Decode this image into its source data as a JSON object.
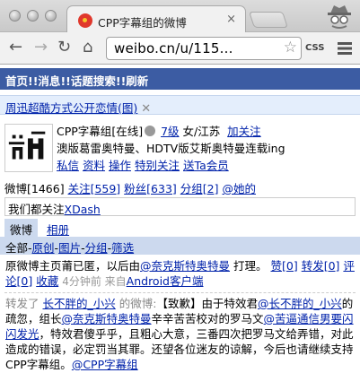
{
  "browser": {
    "tab_title": "CPP字幕组的微博",
    "tab_close": "×",
    "url": "weibo.cn/u/115...",
    "css_label": "CSS"
  },
  "nav": {
    "items": [
      "首页",
      "消息",
      "话题",
      "搜索",
      "刷新"
    ],
    "separator": "!!"
  },
  "notice": {
    "text": "周迅超酷方式公开恋情(图)",
    "close": "✕"
  },
  "profile": {
    "name": "CPP字幕组",
    "status": "[在线]",
    "level": "7级",
    "gender_location": "女/江苏",
    "follow": "加关注",
    "bio": "澳版葛雷奥特曼、HDTV版艾斯奥特曼连载ing",
    "links": [
      "私信",
      "资料",
      "操作",
      "特别关注",
      "送Ta会员"
    ]
  },
  "stats": {
    "weibo": "微博[1466]",
    "following": "关注[559]",
    "fans": "粉丝[633]",
    "groups": "分组[2]",
    "at_her": "@她的"
  },
  "common": {
    "prefix": "我们都关注",
    "user": "XDash"
  },
  "tabs": {
    "weibo": "微博",
    "album": "相册"
  },
  "filter": {
    "all": "全部",
    "original": "原创",
    "pics": "图片",
    "groups": "分组",
    "select": "筛选"
  },
  "post1": {
    "text_a": "原微博主页莆已匿，以后由",
    "mention": "@奈克斯特奥特曼",
    "text_b": " 打理。",
    "like": "赞[0]",
    "repost": "转发[0]",
    "comment": "评论[0]",
    "fav": "收藏",
    "meta": "4分钟前 来自",
    "source": "Android客户端"
  },
  "post2": {
    "repost_label": "转发了",
    "orig_user": "长不胖的_小兴",
    "weibo_label": "的微博:",
    "text_a": "【致歉】由于特效君",
    "mention1": "@长不胖的_小兴",
    "text_b": "的疏忽，组长",
    "mention2": "@奈克斯特奥特曼",
    "text_c": "辛辛苦苦校对的罗马文",
    "mention3": "@苦逼通信男要闪闪发光",
    "text_d": "，特效君傻乎乎，且粗心大意，三番四次把罗马文给弄错，对此造成的错误，必定罚当其罪。还望各位迷友的谅解，今后也请继续支持CPP字幕组。",
    "mention4": "@CPP字幕组"
  }
}
